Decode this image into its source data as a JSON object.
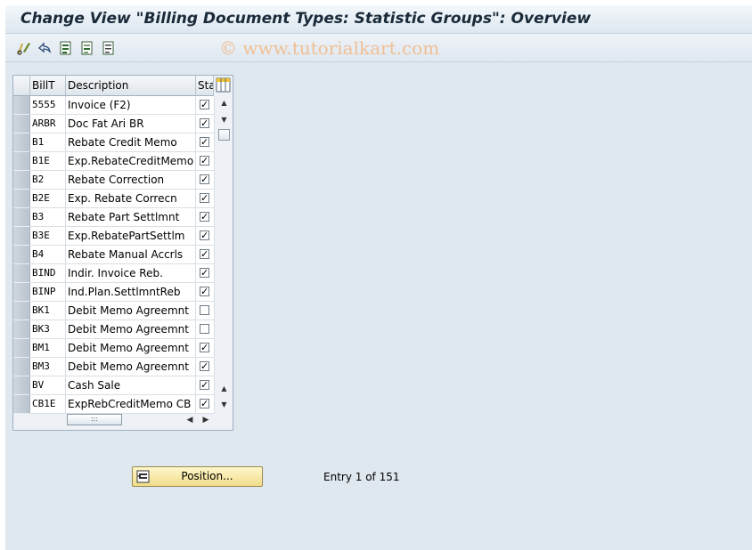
{
  "title": "Change View \"Billing Document Types: Statistic Groups\": Overview",
  "watermark": "© www.tutorialkart.com",
  "toolbar": {
    "icons": [
      "edit-glasses-icon",
      "undo-icon",
      "select-all-icon",
      "deselect-icon",
      "block-select-icon"
    ]
  },
  "table": {
    "headers": {
      "bill_type": "BillT",
      "description": "Description",
      "statistics": "Sta"
    },
    "rows": [
      {
        "bill_type": "5555",
        "description": "Invoice (F2)",
        "checked": true
      },
      {
        "bill_type": "ARBR",
        "description": "Doc Fat Ari BR",
        "checked": true
      },
      {
        "bill_type": "B1",
        "description": "Rebate Credit Memo",
        "checked": true
      },
      {
        "bill_type": "B1E",
        "description": "Exp.RebateCreditMemo",
        "checked": true
      },
      {
        "bill_type": "B2",
        "description": "Rebate Correction",
        "checked": true
      },
      {
        "bill_type": "B2E",
        "description": "Exp. Rebate Correcn",
        "checked": true
      },
      {
        "bill_type": "B3",
        "description": "Rebate Part Settlmnt",
        "checked": true
      },
      {
        "bill_type": "B3E",
        "description": "Exp.RebatePartSettlm",
        "checked": true
      },
      {
        "bill_type": "B4",
        "description": "Rebate Manual Accrls",
        "checked": true
      },
      {
        "bill_type": "BIND",
        "description": "Indir. Invoice Reb.",
        "checked": true
      },
      {
        "bill_type": "BINP",
        "description": "Ind.Plan.SettlmntReb",
        "checked": true
      },
      {
        "bill_type": "BK1",
        "description": "Debit Memo Agreemnt",
        "checked": false
      },
      {
        "bill_type": "BK3",
        "description": "Debit Memo Agreemnt",
        "checked": false
      },
      {
        "bill_type": "BM1",
        "description": "Debit Memo Agreemnt",
        "checked": true
      },
      {
        "bill_type": "BM3",
        "description": "Debit Memo Agreemnt",
        "checked": true
      },
      {
        "bill_type": "BV",
        "description": "Cash Sale",
        "checked": true
      },
      {
        "bill_type": "CB1E",
        "description": "ExpRebCreditMemo CB",
        "checked": true
      }
    ]
  },
  "position_button": {
    "label": "Position..."
  },
  "entry_info": "Entry 1 of 151"
}
